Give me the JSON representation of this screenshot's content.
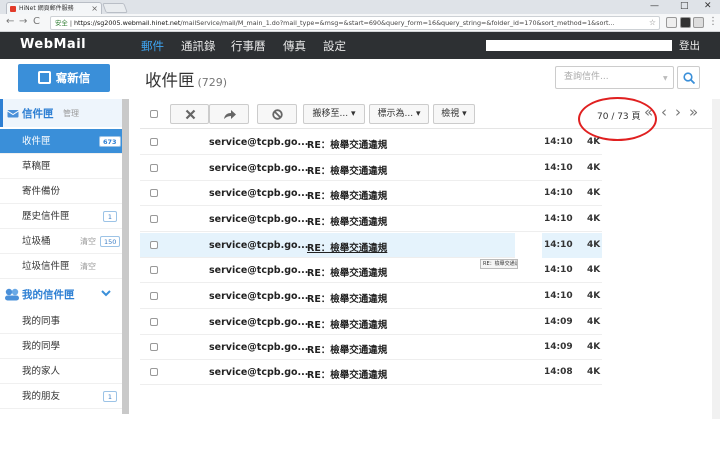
{
  "browser": {
    "tab_title": "HiNet 網頁郵件服務",
    "tab_close": "×",
    "url_secure": "安全",
    "url_host": "https://sg2005.webmail.hinet.net",
    "url_path": "/mailService/mail/M_main_1.do?mail_type=&msg=&start=690&query_form=16&query_string=&folder_id=170&sort_method=1&sort...",
    "back": "←",
    "forward": "→",
    "reload": "C",
    "star": "☆",
    "minimize": "—",
    "maximize": "□",
    "close": "✕",
    "menu": "⋮"
  },
  "header": {
    "logo": "WebMail",
    "nav": [
      "郵件",
      "通訊錄",
      "行事曆",
      "傳真",
      "設定"
    ],
    "active_nav": 0,
    "logout": "登出"
  },
  "sidebar": {
    "compose_label": "寫新信",
    "inbox_header": "信件匣",
    "manage_link": "管理",
    "folders": [
      {
        "label": "收件匣",
        "badge": "673"
      },
      {
        "label": "草稿匣",
        "badge": ""
      },
      {
        "label": "寄件備份",
        "badge": ""
      },
      {
        "label": "歷史信件匣",
        "badge": "1"
      },
      {
        "label": "垃圾桶",
        "link": "清空",
        "badge": "150"
      },
      {
        "label": "垃圾信件匣",
        "link": "清空",
        "badge": ""
      }
    ],
    "my_folders_header": "我的信件匣",
    "my_folders": [
      {
        "label": "我的同事",
        "badge": ""
      },
      {
        "label": "我的同學",
        "badge": ""
      },
      {
        "label": "我的家人",
        "badge": ""
      },
      {
        "label": "我的朋友",
        "badge": "1"
      }
    ]
  },
  "main": {
    "title": "收件匣",
    "count": "(729)",
    "search_placeholder": "查詢信件...",
    "toolbar": {
      "move_to": "搬移至...",
      "mark_as": "標示為...",
      "view": "檢視"
    },
    "pager": "70 / 73 頁",
    "pager_icons": [
      "«",
      "‹",
      "›",
      "»"
    ],
    "tooltip": "RE：檢舉交通違規",
    "highlighted_row": 4,
    "rows": [
      {
        "sender": "service@tcpb.go...",
        "subject": "RE：檢舉交通違規",
        "time": "14:10",
        "size": "4K"
      },
      {
        "sender": "service@tcpb.go...",
        "subject": "RE：檢舉交通違規",
        "time": "14:10",
        "size": "4K"
      },
      {
        "sender": "service@tcpb.go...",
        "subject": "RE：檢舉交通違規",
        "time": "14:10",
        "size": "4K"
      },
      {
        "sender": "service@tcpb.go...",
        "subject": "RE：檢舉交通違規",
        "time": "14:10",
        "size": "4K"
      },
      {
        "sender": "service@tcpb.go...",
        "subject": "RE：檢舉交通違規",
        "time": "14:10",
        "size": "4K"
      },
      {
        "sender": "service@tcpb.go...",
        "subject": "RE：檢舉交通違規",
        "time": "14:10",
        "size": "4K"
      },
      {
        "sender": "service@tcpb.go...",
        "subject": "RE：檢舉交通違規",
        "time": "14:10",
        "size": "4K"
      },
      {
        "sender": "service@tcpb.go...",
        "subject": "RE：檢舉交通違規",
        "time": "14:09",
        "size": "4K"
      },
      {
        "sender": "service@tcpb.go...",
        "subject": "RE：檢舉交通違規",
        "time": "14:09",
        "size": "4K"
      },
      {
        "sender": "service@tcpb.go...",
        "subject": "RE：檢舉交通違規",
        "time": "14:08",
        "size": "4K"
      }
    ]
  },
  "colors": {
    "accent": "#3a8fd9",
    "header_bg": "#2d3033",
    "nav_active": "#3ea3f0",
    "annotation_circle": "#e02020",
    "row_highlight": "#e5f3fc"
  }
}
